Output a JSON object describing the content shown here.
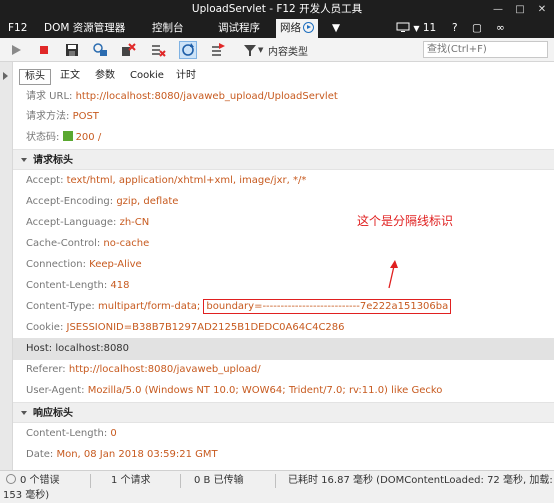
{
  "window": {
    "title": "UploadServlet - F12 开发人员工具",
    "controls": [
      "minimize-icon",
      "maximize-icon",
      "close-icon"
    ]
  },
  "tabs": [
    {
      "label": "F12"
    },
    {
      "label": "DOM 资源管理器"
    },
    {
      "label": "控制台"
    },
    {
      "label": "调试程序"
    },
    {
      "label": "网络",
      "active": true
    },
    {
      "label": "▼"
    },
    {
      "label": "11"
    }
  ],
  "toolbar": {
    "content_type_label": "内容类型",
    "search_placeholder": "查找(Ctrl+F)",
    "icons": [
      "play-icon",
      "stop-icon",
      "save-icon",
      "clear-cache-icon",
      "clear-cookies-icon",
      "clear-entries-icon",
      "always-refresh-icon",
      "clear-on-navigate-icon",
      "filter-icon"
    ]
  },
  "subtabs": [
    {
      "label": "标头",
      "active": true
    },
    {
      "label": "正文"
    },
    {
      "label": "参数"
    },
    {
      "label": "Cookie"
    },
    {
      "label": "计时"
    }
  ],
  "general": {
    "url_label": "请求 URL: ",
    "url_value": "http://localhost:8080/javaweb_upload/UploadServlet",
    "method_label": "请求方法: ",
    "method_value": "POST",
    "status_label": "状态码: ",
    "status_value": "200 /",
    "status_color": "#5aa830"
  },
  "request_headers": {
    "title": "请求标头",
    "items": [
      {
        "name": "Accept: ",
        "value": "text/html, application/xhtml+xml, image/jxr, */*"
      },
      {
        "name": "Accept-Encoding: ",
        "value": "gzip, deflate"
      },
      {
        "name": "Accept-Language: ",
        "value": "zh-CN"
      },
      {
        "name": "Cache-Control: ",
        "value": "no-cache"
      },
      {
        "name": "Connection: ",
        "value": "Keep-Alive"
      },
      {
        "name": "Content-Length: ",
        "value": "418"
      },
      {
        "name": "Content-Type: ",
        "value": "multipart/form-data; ",
        "boundary": "boundary=---------------------------7e222a151306ba"
      },
      {
        "name": "Cookie: ",
        "value": "JSESSIONID=B38B7B1297AD2125B1DEDC0A64C4C286"
      },
      {
        "name": "Host: ",
        "value": "localhost:8080"
      },
      {
        "name": "Referer: ",
        "value": "http://localhost:8080/javaweb_upload/"
      },
      {
        "name": "User-Agent: ",
        "value": "Mozilla/5.0 (Windows NT 10.0; WOW64; Trident/7.0; rv:11.0) like Gecko"
      }
    ]
  },
  "response_headers": {
    "title": "响应标头",
    "items": [
      {
        "name": "Content-Length: ",
        "value": "0"
      },
      {
        "name": "Date: ",
        "value": "Mon, 08 Jan 2018 03:59:21 GMT"
      }
    ]
  },
  "annotation": {
    "text": "这个是分隔线标识",
    "color": "#e02020"
  },
  "statusbar": {
    "errors": "0 个错误",
    "requests": "1 个请求",
    "transferred": "0 B 已传输",
    "elapsed": "已耗时 16.87 毫秒 (DOMContentLoaded: 72 毫秒, 加载:",
    "load_tail": "153 毫秒)"
  }
}
